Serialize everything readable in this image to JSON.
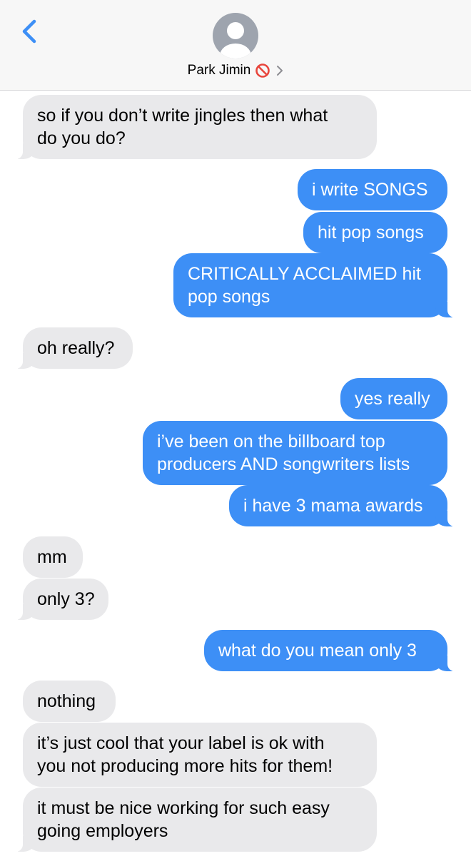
{
  "header": {
    "contact_name": "Park Jimin",
    "icons": [
      "back-chevron-icon",
      "avatar-placeholder-icon",
      "blocked-icon",
      "chevron-right-icon"
    ],
    "accent_color": "#3d8ff6",
    "blocked_color": "#e8453c"
  },
  "messages": [
    {
      "from": "them",
      "lines": [
        "so if you don’t write jingles then what",
        "do you do?"
      ]
    },
    {
      "from": "me",
      "lines": [
        "i write SONGS"
      ]
    },
    {
      "from": "me",
      "lines": [
        "hit pop songs"
      ]
    },
    {
      "from": "me",
      "lines": [
        "CRITICALLY ACCLAIMED hit",
        "pop songs"
      ]
    },
    {
      "from": "them",
      "lines": [
        "oh really?"
      ]
    },
    {
      "from": "me",
      "lines": [
        "yes really"
      ]
    },
    {
      "from": "me",
      "lines": [
        "i’ve been on the billboard top",
        "producers AND songwriters lists"
      ]
    },
    {
      "from": "me",
      "lines": [
        "i have 3 mama awards"
      ]
    },
    {
      "from": "them",
      "lines": [
        "mm"
      ]
    },
    {
      "from": "them",
      "lines": [
        "only 3?"
      ]
    },
    {
      "from": "me",
      "lines": [
        "what do you mean only 3"
      ]
    },
    {
      "from": "them",
      "lines": [
        "nothing"
      ]
    },
    {
      "from": "them",
      "lines": [
        "it’s just cool that your label is ok with",
        "you not producing more hits for them!"
      ]
    },
    {
      "from": "them",
      "lines": [
        "it must be nice working for such easy",
        "going employers"
      ]
    }
  ]
}
